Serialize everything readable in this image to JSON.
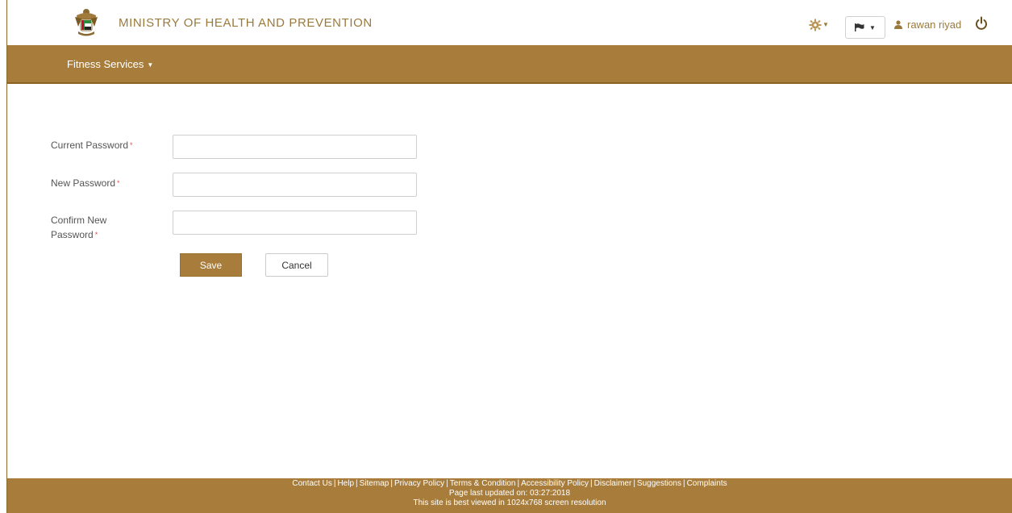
{
  "header": {
    "ministry_title": "MINISTRY OF HEALTH AND PREVENTION",
    "user_name": "rawan riyad"
  },
  "nav": {
    "menu_label": "Fitness Services"
  },
  "form": {
    "current_password_label": "Current Password",
    "new_password_label": "New Password",
    "confirm_label_line1": "Confirm New",
    "confirm_label_line2": "Password",
    "required_mark": "*",
    "current_password_value": "",
    "new_password_value": "",
    "confirm_password_value": "",
    "save_label": "Save",
    "cancel_label": "Cancel"
  },
  "footer": {
    "links": [
      "Contact Us",
      "Help",
      "Sitemap",
      "Privacy Policy",
      "Terms & Condition",
      "Accessibility Policy",
      "Disclaimer",
      "Suggestions",
      "Complaints"
    ],
    "separator": "|",
    "last_updated": "Page last updated on: 03:27:2018",
    "resolution_note": "This site is best viewed in 1024x768 screen resolution"
  },
  "colors": {
    "brand": "#a87d3c",
    "text_gold": "#9a7a3c",
    "required": "#d9534f"
  },
  "icons": [
    "emblem-logo",
    "gear-icon",
    "flag-icon",
    "person-icon",
    "power-icon",
    "caret-down-icon"
  ]
}
